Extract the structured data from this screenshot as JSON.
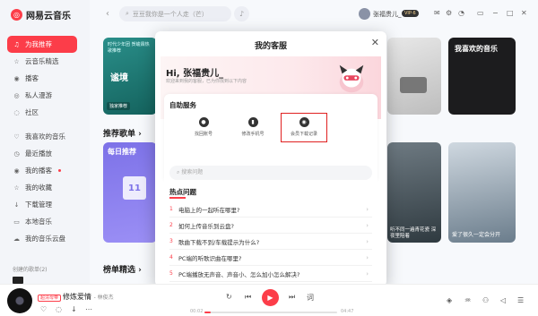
{
  "app": {
    "logo_text": "网易云音乐"
  },
  "sidebar": {
    "items": [
      {
        "label": "为我推荐",
        "icon": "headphones-icon",
        "glyph": "♫",
        "active": true
      },
      {
        "label": "云音乐精选",
        "icon": "star-icon",
        "glyph": "☆"
      },
      {
        "label": "播客",
        "icon": "podcast-icon",
        "glyph": "◉"
      },
      {
        "label": "私人漫游",
        "icon": "radio-icon",
        "glyph": "◎"
      },
      {
        "label": "社区",
        "icon": "chat-icon",
        "glyph": "◌"
      }
    ],
    "my_items": [
      {
        "label": "我喜欢的音乐",
        "icon": "heart-icon",
        "glyph": "♡"
      },
      {
        "label": "最近播放",
        "icon": "history-icon",
        "glyph": "◷"
      },
      {
        "label": "我的播客",
        "icon": "podcast-icon",
        "glyph": "◉",
        "dot": true
      },
      {
        "label": "我的收藏",
        "icon": "collect-icon",
        "glyph": "☆"
      },
      {
        "label": "下载管理",
        "icon": "download-icon",
        "glyph": "↓"
      },
      {
        "label": "本地音乐",
        "icon": "folder-icon",
        "glyph": "▭"
      },
      {
        "label": "我的音乐云盘",
        "icon": "cloud-icon",
        "glyph": "☁"
      }
    ],
    "created_label": "创建的歌单(2)"
  },
  "topbar": {
    "search_placeholder": "豆豆我你是一个人走（芒）",
    "username": "张福贵儿_",
    "vip": "VIP·6"
  },
  "content": {
    "banner_text": "时代少年团 贺峻霖热歌推荐",
    "banner_title": "谧境",
    "banner_tag": "独家推荐",
    "my_fav": "我喜欢的音乐",
    "section_recommend": "推荐歌单 ›",
    "daily": "每日推荐",
    "daily_date": "11",
    "card_caption_1": "听不同一遍青花瓷 深夜里陪着",
    "card_caption_2": "爱了很久一定会分开",
    "section_picks": "榜单精选 ›"
  },
  "modal": {
    "title": "我的客服",
    "greeting": "Hi, 张福贵儿_",
    "greeting_sub": "欢迎来到我的客服，已为你找到以下内容",
    "self_service_title": "自助服务",
    "services": [
      {
        "label": "找回账号",
        "icon": "account-icon"
      },
      {
        "label": "修改手机号",
        "icon": "phone-icon"
      },
      {
        "label": "会员下载记录",
        "icon": "download-record-icon",
        "highlighted": true
      }
    ],
    "faq_search_placeholder": "搜索问题",
    "faq_title": "热点问题",
    "faq": [
      "电脑上的一起听在哪里?",
      "如何上传音乐到云盘?",
      "歌曲下载不到/车载提示为什么?",
      "PC端的听歌识曲在哪里?",
      "PC端播放无声音、声音小、怎么加小怎么解决?"
    ]
  },
  "player": {
    "song_title": "修炼爱情",
    "artist": "林俊杰",
    "tag": "超清母带",
    "time_current": "00:02",
    "time_total": "04:47",
    "progress": 0.02
  },
  "colors": {
    "accent": "#fc3d49",
    "highlight_box": "#e02020"
  }
}
